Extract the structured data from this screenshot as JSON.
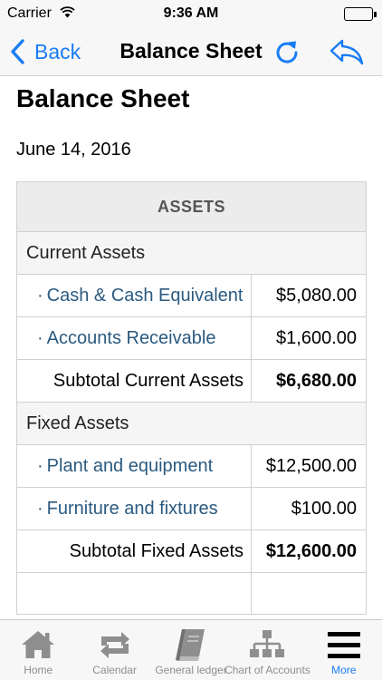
{
  "status_bar": {
    "carrier": "Carrier",
    "time": "9:36 AM"
  },
  "nav": {
    "back_label": "Back",
    "title": "Balance Sheet"
  },
  "report": {
    "title": "Balance Sheet",
    "date": "June 14, 2016"
  },
  "assets": {
    "header": "ASSETS",
    "current": {
      "heading": "Current Assets",
      "items": [
        {
          "name": "Cash & Cash Equivalent",
          "amount": "$5,080.00"
        },
        {
          "name": "Accounts Receivable",
          "amount": "$1,600.00"
        }
      ],
      "subtotal_label": "Subtotal Current Assets",
      "subtotal_amount": "$6,680.00"
    },
    "fixed": {
      "heading": "Fixed Assets",
      "items": [
        {
          "name": "Plant and equipment",
          "amount": "$12,500.00"
        },
        {
          "name": "Furniture and fixtures",
          "amount": "$100.00"
        }
      ],
      "subtotal_label": "Subtotal Fixed Assets",
      "subtotal_amount": "$12,600.00"
    }
  },
  "tabs": [
    {
      "label": "Home",
      "icon": "home-icon"
    },
    {
      "label": "Calendar",
      "icon": "repeat-icon"
    },
    {
      "label": "General ledger",
      "icon": "book-icon"
    },
    {
      "label": "Chart of Accounts",
      "icon": "org-chart-icon"
    },
    {
      "label": "More",
      "icon": "menu-icon"
    }
  ],
  "active_tab": "More",
  "colors": {
    "accent": "#1a7cf5",
    "link": "#2a5a80",
    "tab_inactive": "#8e8e8e"
  }
}
